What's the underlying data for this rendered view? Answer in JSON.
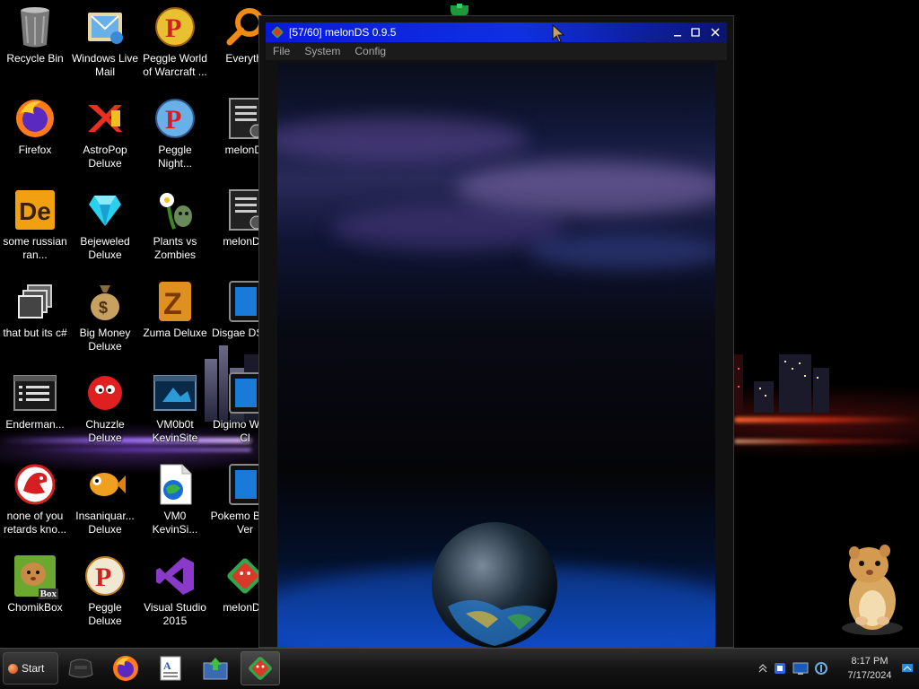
{
  "desktop": {
    "icons": [
      {
        "label": "Recycle Bin",
        "icon": "recycle-bin-icon"
      },
      {
        "label": "Windows Live Mail",
        "icon": "windows-live-mail-icon"
      },
      {
        "label": "Peggle World of Warcraft ...",
        "icon": "peggle-icon"
      },
      {
        "label": "Everythi",
        "icon": "everything-search-icon"
      },
      {
        "label": "Firefox",
        "icon": "firefox-icon"
      },
      {
        "label": "AstroPop Deluxe",
        "icon": "astropop-icon"
      },
      {
        "label": "Peggle Night...",
        "icon": "peggle-nights-icon"
      },
      {
        "label": "melonD:",
        "icon": "document-icon"
      },
      {
        "label": "some russian ran...",
        "icon": "de-app-icon"
      },
      {
        "label": "Bejeweled Deluxe",
        "icon": "bejeweled-icon"
      },
      {
        "label": "Plants vs Zombies",
        "icon": "plants-vs-zombies-icon"
      },
      {
        "label": "melonDS",
        "icon": "document-icon"
      },
      {
        "label": "that but its c#",
        "icon": "stacked-windows-icon"
      },
      {
        "label": "Big Money Deluxe",
        "icon": "money-bag-icon"
      },
      {
        "label": "Zuma Deluxe",
        "icon": "zuma-icon"
      },
      {
        "label": "Disgae DS.nd",
        "icon": "nds-rom-icon"
      },
      {
        "label": "Enderman...",
        "icon": "console-window-icon"
      },
      {
        "label": "Chuzzle Deluxe",
        "icon": "chuzzle-icon"
      },
      {
        "label": "VM0b0t KevinSite",
        "icon": "vm-window-icon"
      },
      {
        "label": "Digimo World Cl",
        "icon": "nds-rom-icon"
      },
      {
        "label": "none of you retards kno...",
        "icon": "red-mascot-icon"
      },
      {
        "label": "Insaniquar... Deluxe",
        "icon": "insaniquarium-icon"
      },
      {
        "label": "VM0 KevinSi...",
        "icon": "html-file-icon"
      },
      {
        "label": "Pokemo Black Ver",
        "icon": "nds-rom-icon"
      },
      {
        "label": "ChomikBox",
        "icon": "chomikbox-icon"
      },
      {
        "label": "Peggle Deluxe",
        "icon": "peggle-icon"
      },
      {
        "label": "Visual Studio 2015",
        "icon": "visual-studio-icon"
      },
      {
        "label": "melonDS",
        "icon": "melonds-icon"
      }
    ],
    "chomik_badge": "Box"
  },
  "window": {
    "title": "[57/60] melonDS 0.9.5",
    "menu": [
      "File",
      "System",
      "Config"
    ]
  },
  "taskbar": {
    "start_label": "Start",
    "pinned": [
      "console-app-icon",
      "firefox-icon",
      "document-app-icon",
      "download-app-icon",
      "melonds-icon"
    ],
    "clock_time": "8:17 PM",
    "clock_date": "7/17/2024"
  },
  "colors": {
    "title_bar": "#1030e0",
    "taskbar": "#141414",
    "melon_red": "#d83a2a",
    "melon_green": "#2fa84a"
  }
}
